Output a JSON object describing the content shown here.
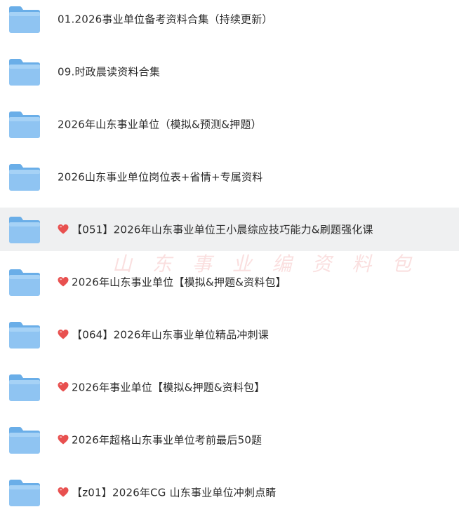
{
  "folders": [
    {
      "label": "01.2026事业单位备考资料合集（持续更新）",
      "heart": false,
      "selected": false
    },
    {
      "label": "09.时政晨读资料合集",
      "heart": false,
      "selected": false
    },
    {
      "label": "2026年山东事业单位（模拟&预测&押题）",
      "heart": false,
      "selected": false
    },
    {
      "label": "2026山东事业单位岗位表+省情+专属资料",
      "heart": false,
      "selected": false
    },
    {
      "label": "【051】2026年山东事业单位王小晨综应技巧能力&刷题强化课",
      "heart": true,
      "selected": true
    },
    {
      "label": "2026年山东事业单位【模拟&押题&资料包】",
      "heart": true,
      "selected": false
    },
    {
      "label": "【064】2026年山东事业单位精品冲刺课",
      "heart": true,
      "selected": false
    },
    {
      "label": "2026年事业单位【模拟&押题&资料包】",
      "heart": true,
      "selected": false
    },
    {
      "label": "2026年超格山东事业单位考前最后50题",
      "heart": true,
      "selected": false
    },
    {
      "label": "【z01】2026年CG 山东事业单位冲刺点睛",
      "heart": true,
      "selected": false
    }
  ],
  "watermark": "山 东 事 业 编 资 料 包",
  "icons": {
    "folder": "folder-icon",
    "heart": "heart-icon"
  },
  "colors": {
    "selected_row": "#eff0f1",
    "heart": "#e8504f",
    "folder": "#8fc4f2"
  }
}
